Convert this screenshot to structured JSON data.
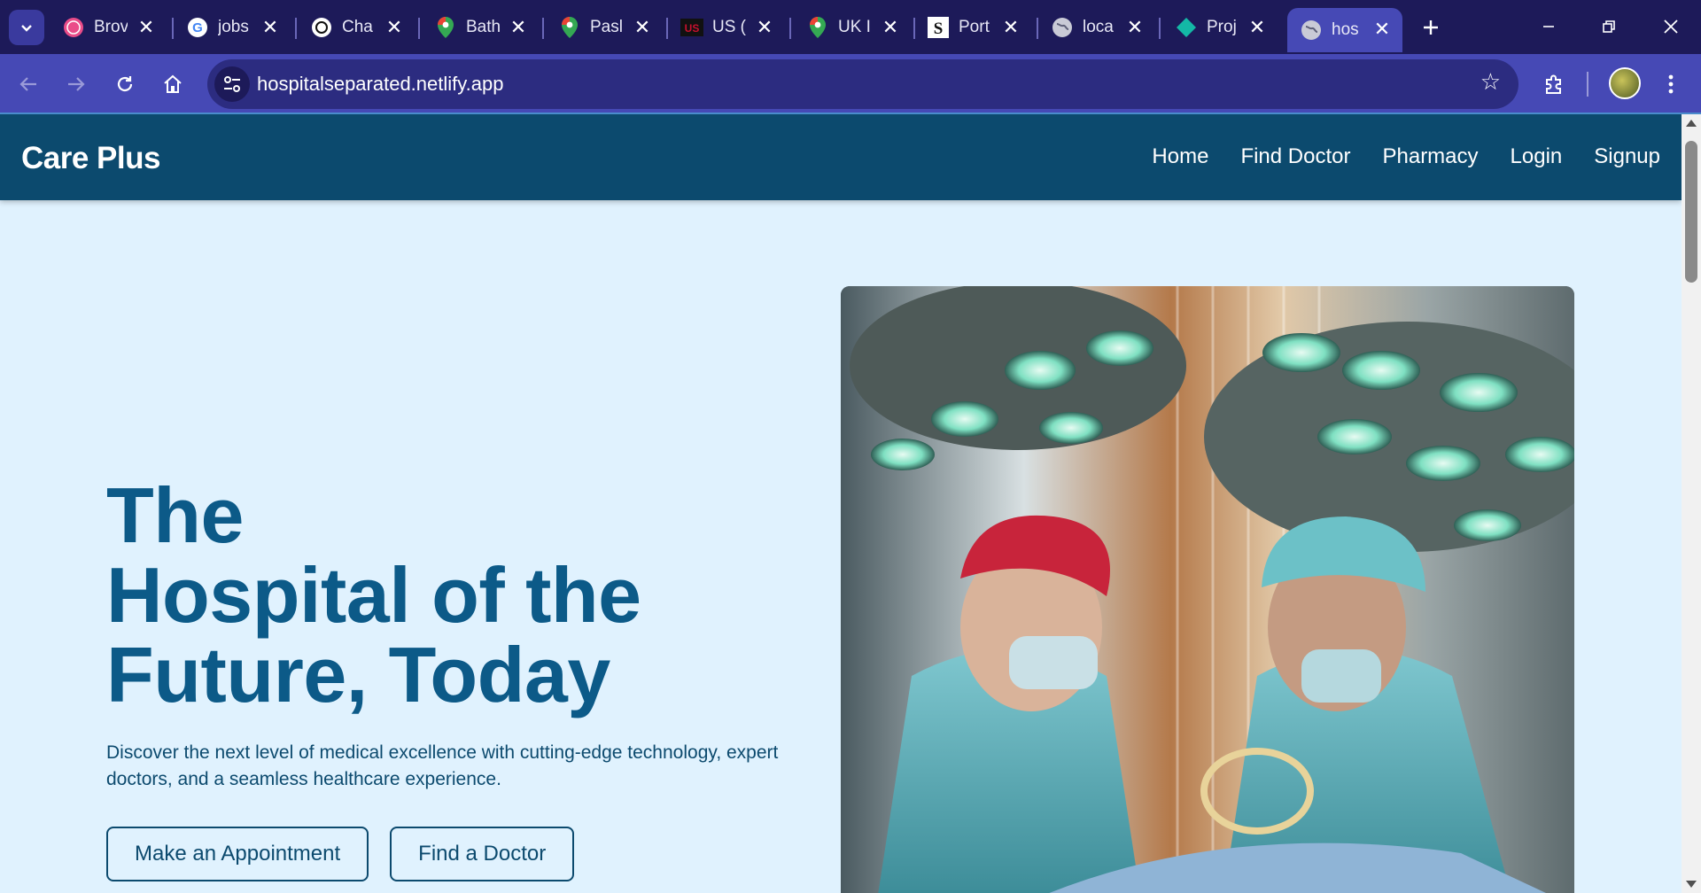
{
  "browser": {
    "tabs": [
      {
        "title": "Brov",
        "icon": "dribbble-icon"
      },
      {
        "title": "jobs",
        "icon": "google-icon"
      },
      {
        "title": "Cha",
        "icon": "chatgpt-icon"
      },
      {
        "title": "Bath",
        "icon": "maps-pin-icon"
      },
      {
        "title": "Pasl",
        "icon": "maps-pin-icon"
      },
      {
        "title": "US (",
        "icon": "us-logo-icon"
      },
      {
        "title": "UK I",
        "icon": "maps-pin-icon"
      },
      {
        "title": "Port",
        "icon": "s-logo-icon"
      },
      {
        "title": "loca",
        "icon": "globe-icon"
      },
      {
        "title": "Proj",
        "icon": "diamond-icon"
      },
      {
        "title": "hos",
        "icon": "globe-icon",
        "active": true
      }
    ],
    "url": "hospitalseparated.netlify.app"
  },
  "site": {
    "brand": "Care Plus",
    "nav": [
      "Home",
      "Find Doctor",
      "Pharmacy",
      "Login",
      "Signup"
    ]
  },
  "hero": {
    "title_line1": "The",
    "title_line2": "Hospital of the",
    "title_line3": "Future, Today",
    "subtitle": "Discover the next level of medical excellence with cutting-edge technology, expert doctors, and a seamless healthcare experience.",
    "buttons": [
      "Make an Appointment",
      "Find a Doctor"
    ]
  },
  "colors": {
    "nav_bg": "#0c4a6e",
    "page_bg": "#e0f2fe",
    "title": "#0c5a88"
  }
}
